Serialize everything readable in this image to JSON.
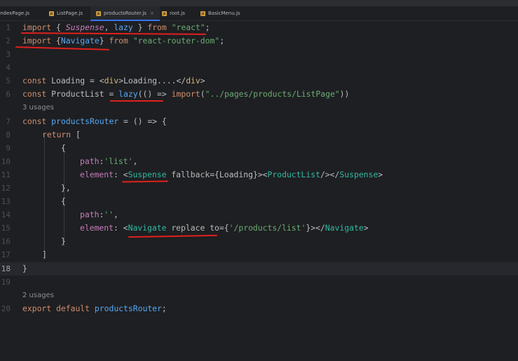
{
  "tabs": [
    {
      "label": "IndexPage.js",
      "active": false,
      "icon": "js-file-icon"
    },
    {
      "label": "ListPage.js",
      "active": false,
      "icon": "js-file-icon"
    },
    {
      "label": "productsRouter.js",
      "active": true,
      "icon": "js-file-icon",
      "close": "×"
    },
    {
      "label": "root.js",
      "active": false,
      "icon": "js-file-icon"
    },
    {
      "label": "BasicMenu.js",
      "active": false,
      "icon": "js-file-icon"
    }
  ],
  "gutter": [
    "1",
    "2",
    "3",
    "4",
    "5",
    "6",
    "7",
    "8",
    "9",
    "10",
    "11",
    "12",
    "13",
    "14",
    "15",
    "16",
    "17",
    "18",
    "19",
    "20"
  ],
  "current_line": "18",
  "hints": {
    "usages_3": "3 usages",
    "usages_2": "2 usages"
  },
  "code": {
    "l1": {
      "import": "import",
      "b1": " { ",
      "suspense": "Suspense",
      "c": ", ",
      "lazy": "lazy",
      "b2": " } ",
      "from": "from",
      "sp": " ",
      "src": "\"react\"",
      "end": ";"
    },
    "l2": {
      "import": "import",
      "b1": " {",
      "navigate": "Navigate",
      "b2": "} ",
      "from": "from",
      "sp": " ",
      "src": "\"react-router-dom\"",
      "end": ";"
    },
    "l5": {
      "const": "const",
      "name": " Loading = ",
      "o": "<",
      "tag": "div",
      "c1": ">",
      "text": "Loading....",
      "cl": "</",
      "tag2": "div",
      "c2": ">"
    },
    "l6": {
      "const": "const",
      "name": " ProductList = ",
      "lazy": "lazy",
      "paren": "(() => ",
      "import": "import",
      "src1": "(",
      "path": "\"../pages/products/ListPage\"",
      "end": "))"
    },
    "l7": {
      "const": "const",
      "sp": " ",
      "fn": "productsRouter",
      "rest": " = () => {"
    },
    "l8": {
      "ret": "return",
      "rest": " ["
    },
    "l9": "{",
    "l10": {
      "key": "path",
      "colon": ":",
      "val": "'list'",
      "end": ","
    },
    "l11": {
      "key": "element",
      "colon": ": ",
      "o1": "<",
      "t1": "Suspense",
      "attr": " fallback",
      "eq": "={",
      "ref": "Loading",
      "cb": "}>",
      "o2": "<",
      "t2": "ProductList",
      "c2": "/></",
      "t3": "Suspense",
      "c3": ">"
    },
    "l12": "},",
    "l13": "{",
    "l14": {
      "key": "path",
      "colon": ":",
      "val": "''",
      "end": ","
    },
    "l15": {
      "key": "element",
      "colon": ": ",
      "o1": "<",
      "t1": "Navigate",
      "attr1": " replace",
      "attr2": " to",
      "eq": "={",
      "val": "'/products/list'",
      "cb": "}></",
      "t2": "Navigate",
      "c2": ">"
    },
    "l16": "}",
    "l17": "]",
    "l18": "}",
    "l20": {
      "export": "export",
      "sp": " ",
      "default": "default",
      "sp2": " ",
      "name": "productsRouter",
      "end": ";"
    }
  },
  "annotation_color": "#e0201d"
}
